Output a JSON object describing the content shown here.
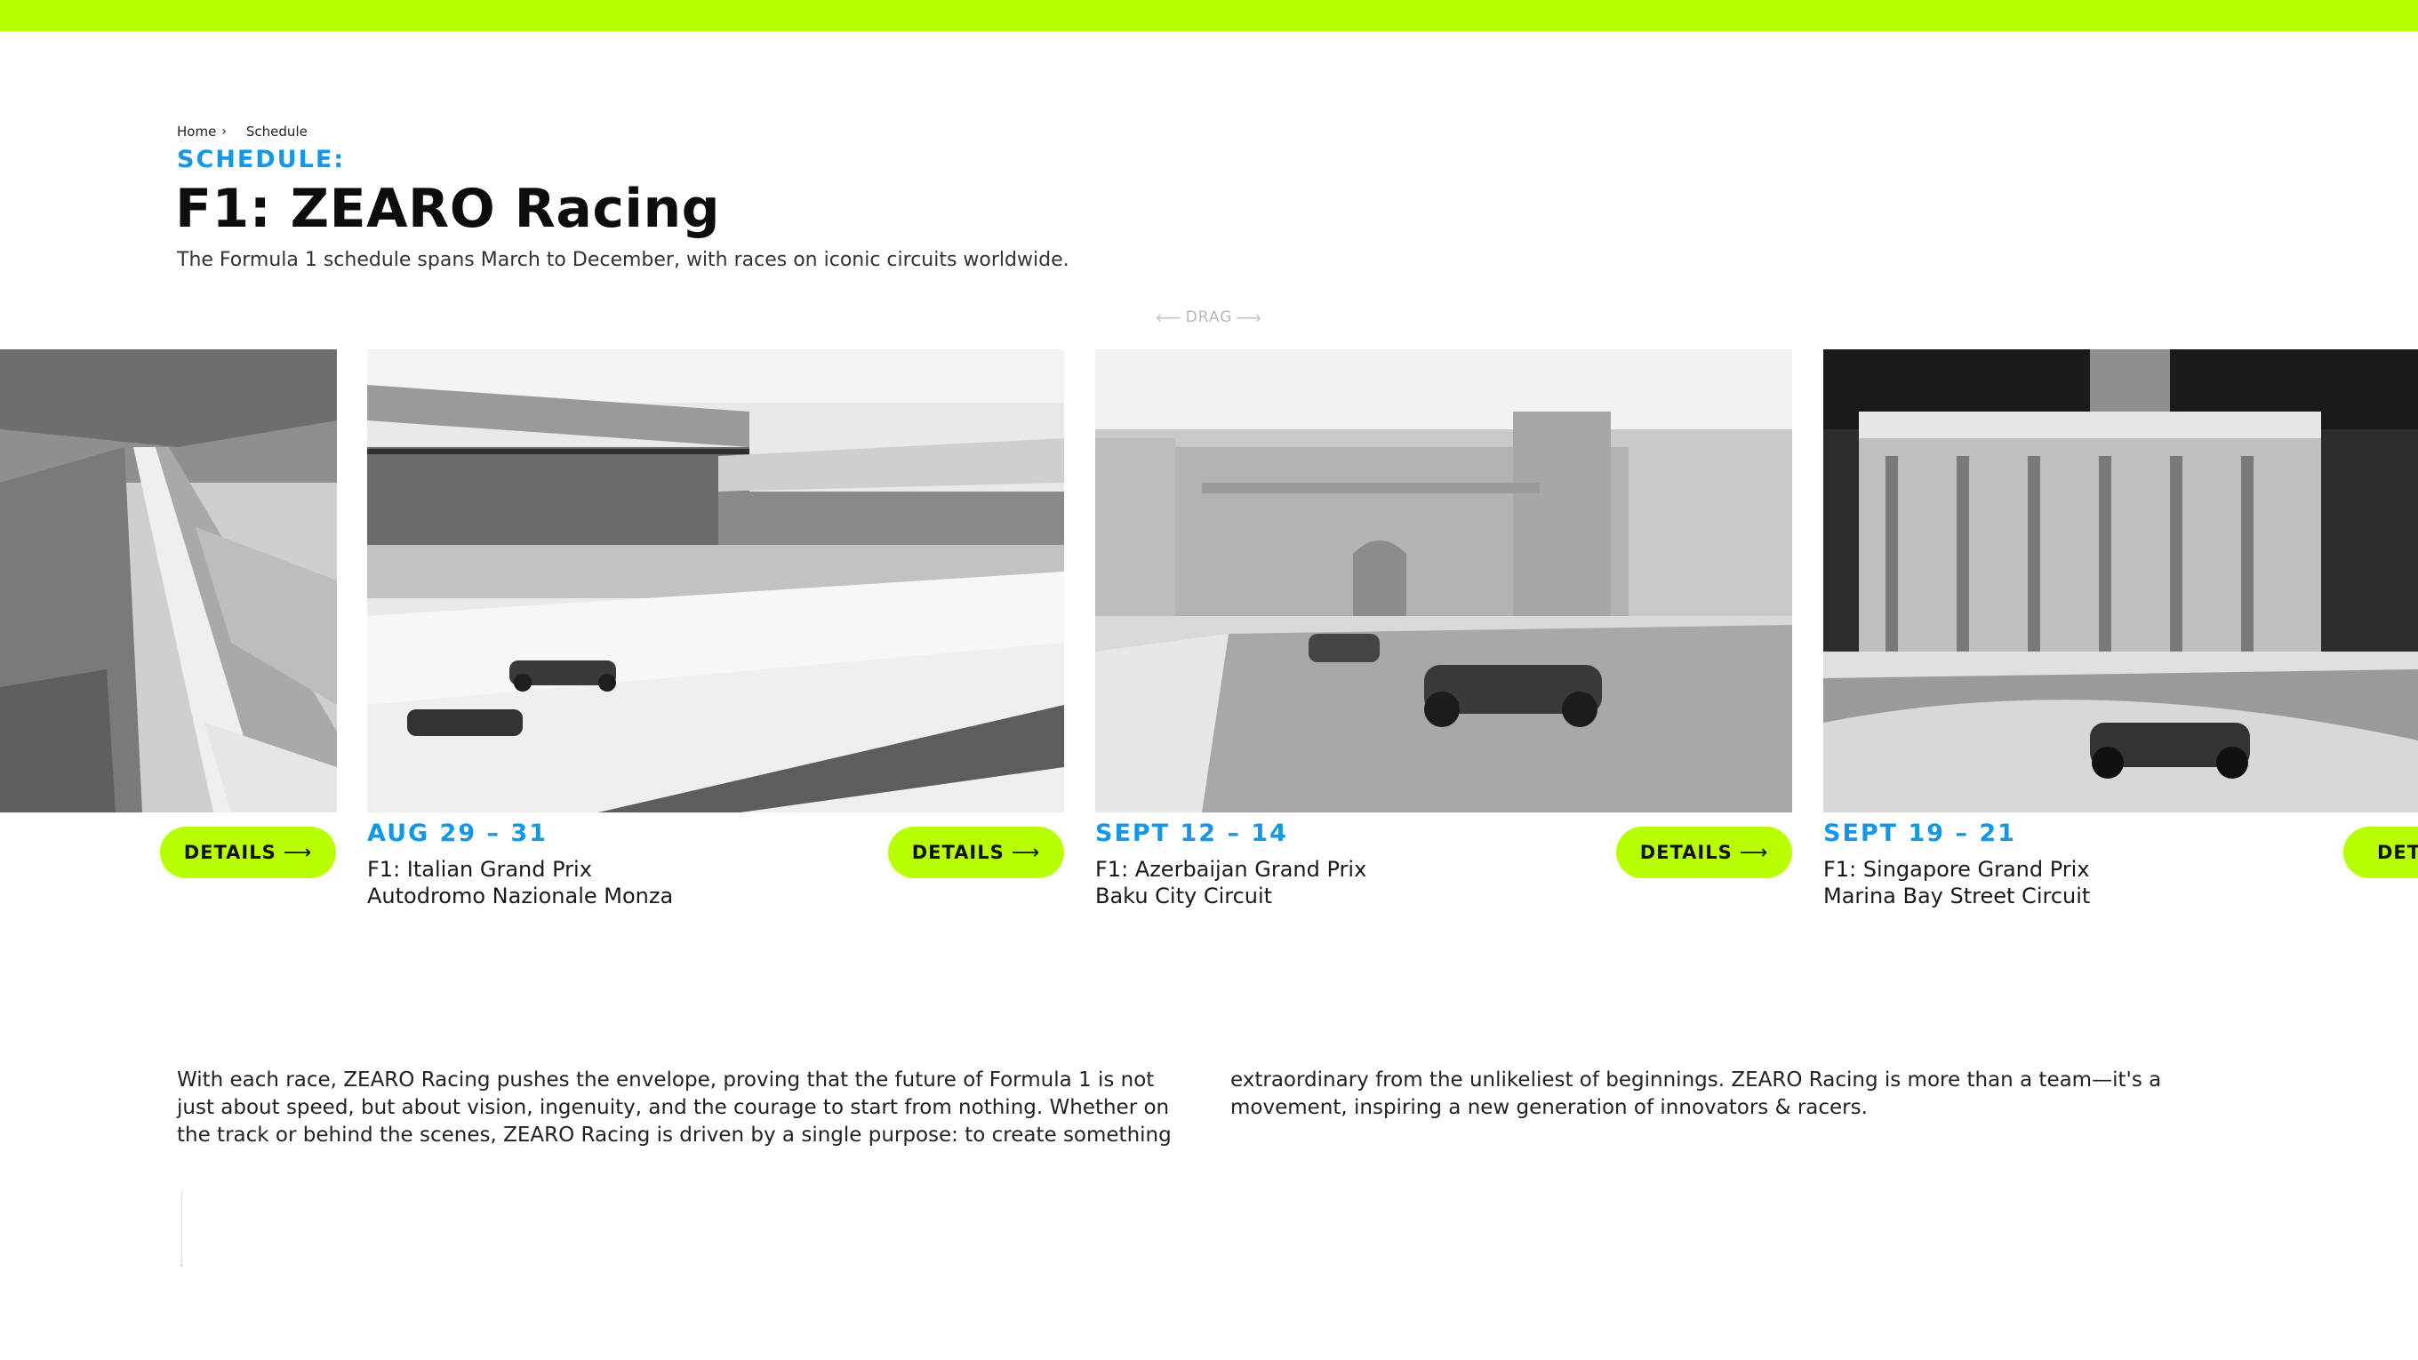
{
  "breadcrumb": {
    "home": "Home",
    "separator": "›",
    "current": "Schedule"
  },
  "header": {
    "eyebrow": "SCHEDULE:",
    "title": "F1: ZEARO Racing",
    "subtitle": "The Formula 1 schedule spans March to December, with races on iconic circuits worldwide."
  },
  "drag_hint": {
    "label": "DRAG",
    "left_icon": "arrow-left-icon",
    "right_icon": "arrow-right-icon"
  },
  "schedule": {
    "details_label": "DETAILS",
    "details_icon": "arrow-right-icon",
    "cards": [
      {
        "date": "AUG 29 – 31",
        "race": "F1: Italian Grand Prix",
        "circuit": "Autodromo Nazionale Monza"
      },
      {
        "date": "SEPT 12 – 14",
        "race": "F1: Azerbaijan Grand Prix",
        "circuit": "Baku City Circuit"
      },
      {
        "date": "SEPT 19 – 21",
        "race": "F1: Singapore Grand Prix",
        "circuit": "Marina Bay Street Circuit"
      }
    ],
    "partial_right_label": "DET"
  },
  "body": {
    "col1": "With each race, ZEARO Racing pushes the envelope, proving that the future of Formula 1 is not just about speed, but about vision, ingenuity, and the courage to start from nothing. Whether on the track or behind the scenes, ZEARO Racing is driven by a single purpose: to create something",
    "col2": "extraordinary from the unlikeliest of beginnings. ZEARO Racing is more than a team—it's a movement, inspiring a new generation of innovators & racers."
  },
  "colors": {
    "accent": "#b8ff00",
    "date_blue": "#1597e5",
    "text": "#111111"
  }
}
